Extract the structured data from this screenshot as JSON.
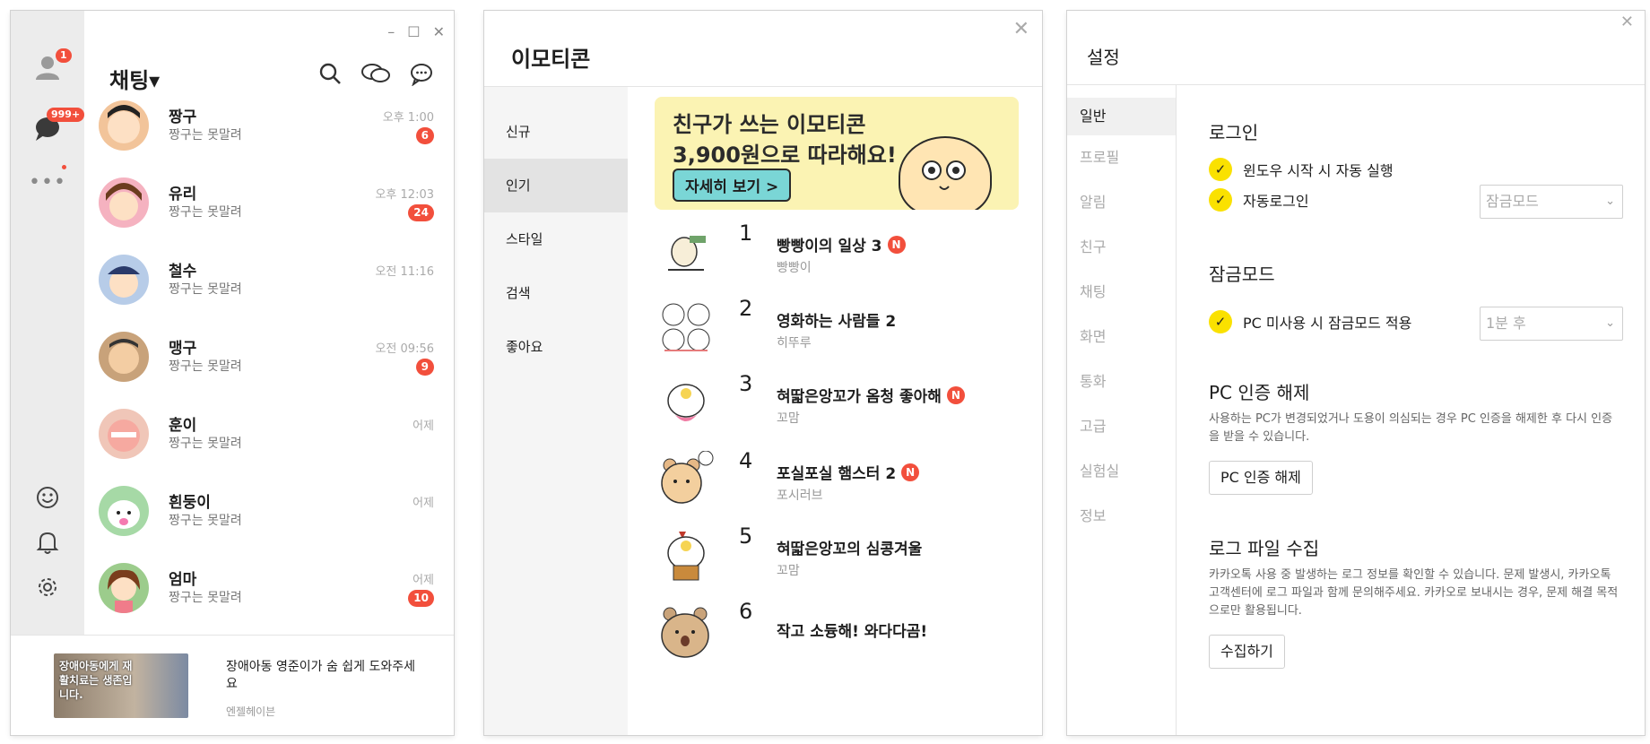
{
  "chat": {
    "header_title": "채팅▾",
    "profile_badge": "1",
    "chat_badge": "999+",
    "rooms": [
      {
        "name": "짱구",
        "preview": "짱구는 못말려",
        "time": "오후 1:00",
        "unread": "6",
        "color": "#f2c49a"
      },
      {
        "name": "유리",
        "preview": "짱구는 못말려",
        "time": "오후 12:03",
        "unread": "24",
        "color": "#f5b2c0"
      },
      {
        "name": "철수",
        "preview": "짱구는 못말려",
        "time": "오전 11:16",
        "unread": "",
        "color": "#b7cce8"
      },
      {
        "name": "맹구",
        "preview": "짱구는 못말려",
        "time": "오전 09:56",
        "unread": "9",
        "color": "#c8a27a"
      },
      {
        "name": "훈이",
        "preview": "짱구는 못말려",
        "time": "어제",
        "unread": "",
        "color": "#f0c6b8"
      },
      {
        "name": "흰둥이",
        "preview": "짱구는 못말려",
        "time": "어제",
        "unread": "",
        "color": "#a6d9a6"
      },
      {
        "name": "엄마",
        "preview": "짱구는 못말려",
        "time": "어제",
        "unread": "10",
        "color": "#9ccc8c"
      }
    ],
    "ad": {
      "image_text": "장애아동에게 재활치료는 생존입니다.",
      "title": "장애아동 영준이가 숨 쉽게 도와주세요",
      "source": "엔젤헤이븐"
    }
  },
  "emoticon": {
    "title": "이모티콘",
    "nav": [
      "신규",
      "인기",
      "스타일",
      "검색",
      "좋아요"
    ],
    "banner": {
      "line1": "친구가 쓰는 이모티콘",
      "line2": "3,900원으로 따라해요!",
      "button": "자세히 보기 >"
    },
    "items": [
      {
        "rank": "1",
        "name": "빵빵이의 일상 3",
        "author": "빵빵이",
        "new": "N",
        "color": "#f4f4f4"
      },
      {
        "rank": "2",
        "name": "영화하는 사람들 2",
        "author": "히뚜루",
        "new": "",
        "color": "#f4f4f4"
      },
      {
        "rank": "3",
        "name": "혀딻은앙꼬가 옴청 좋아해",
        "author": "꼬맘",
        "new": "N",
        "color": "#fff1e0"
      },
      {
        "rank": "4",
        "name": "포실포실 햄스터 2",
        "author": "포시러브",
        "new": "N",
        "color": "#fde7c5"
      },
      {
        "rank": "5",
        "name": "혀딻은앙꼬의 심콩겨울",
        "author": "꼬맘",
        "new": "",
        "color": "#fff1e0"
      },
      {
        "rank": "6",
        "name": "작고 소듕해! 와다다곰!",
        "author": "",
        "new": "",
        "color": "#f1d9b5"
      }
    ]
  },
  "settings": {
    "title": "설정",
    "nav": [
      "일반",
      "프로필",
      "알림",
      "친구",
      "채팅",
      "화면",
      "통화",
      "고급",
      "실험실",
      "정보"
    ],
    "login": {
      "heading": "로그인",
      "autostart": "윈도우 시작 시 자동 실행",
      "autologin": "자동로그인",
      "autologin_select": "잠금모드"
    },
    "lock": {
      "heading": "잠금모드",
      "option": "PC 미사용 시 잠금모드 적용",
      "select": "1분 후"
    },
    "pc_auth": {
      "heading": "PC 인증 해제",
      "desc": "사용하는 PC가 변경되었거나 도용이 의심되는 경우 PC 인증을 해제한 후 다시 인증을 받을 수 있습니다.",
      "button": "PC 인증 해제"
    },
    "log": {
      "heading": "로그 파일 수집",
      "desc": "카카오톡 사용 중 발생하는 로그 정보를 확인할 수 있습니다. 문제 발생시, 카카오톡 고객센터에 로그 파일과 함께 문의해주세요. 카카오로 보내시는 경우, 문제 해결 목적으로만 활용됩니다.",
      "button": "수집하기"
    }
  }
}
